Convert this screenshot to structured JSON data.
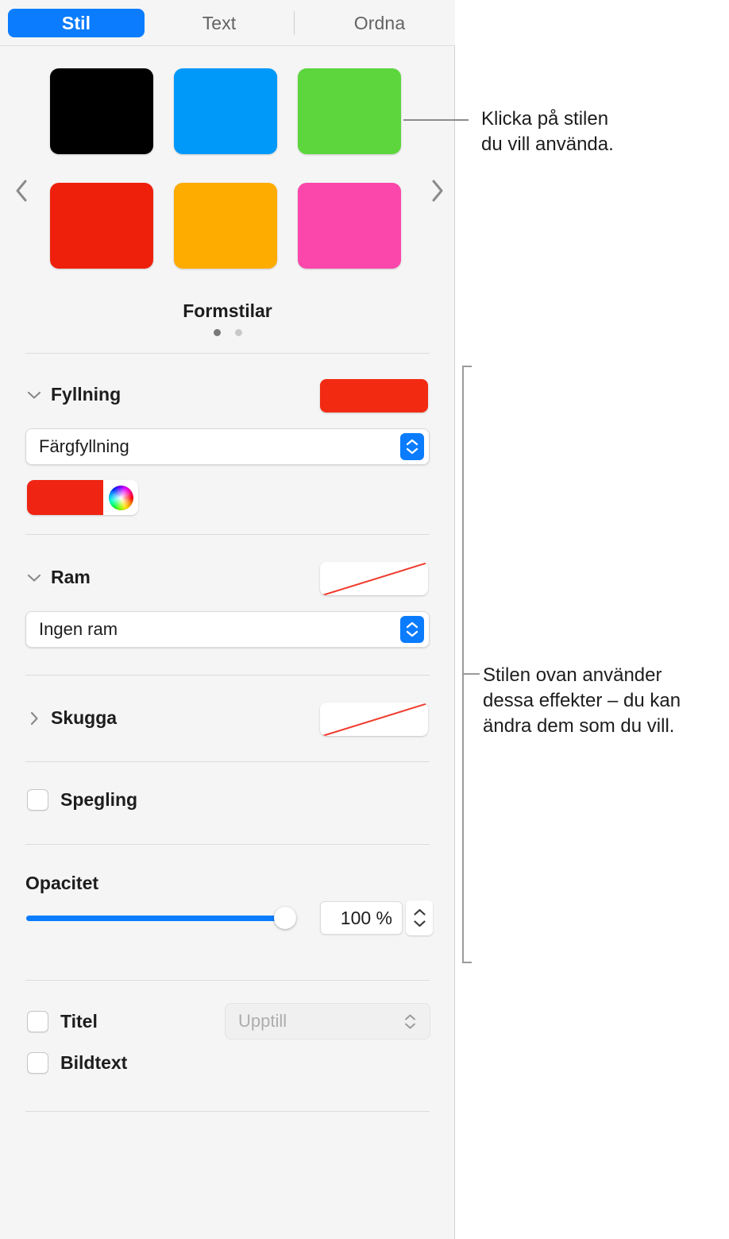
{
  "tabs": [
    {
      "label": "Stil",
      "selected": true
    },
    {
      "label": "Text",
      "selected": false
    },
    {
      "label": "Ordna",
      "selected": false
    }
  ],
  "style_picker": {
    "label": "Formstilar",
    "prev_icon": "chevron-left-icon",
    "next_icon": "chevron-right-icon",
    "page_dots": 2,
    "active_page": 1,
    "swatches": [
      {
        "name": "style-swatch-black",
        "color": "#000000"
      },
      {
        "name": "style-swatch-blue",
        "color": "#0099fa"
      },
      {
        "name": "style-swatch-green",
        "color": "#5cd63c"
      },
      {
        "name": "style-swatch-red",
        "color": "#ee200c"
      },
      {
        "name": "style-swatch-orange",
        "color": "#ffac00"
      },
      {
        "name": "style-swatch-pink",
        "color": "#fb46ab"
      }
    ]
  },
  "fill": {
    "title": "Fyllning",
    "expanded": true,
    "preview_color": "#f22a12",
    "type_value": "Färgfyllning",
    "color_value": "#ef2412"
  },
  "border": {
    "title": "Ram",
    "expanded": true,
    "preview_kind": "none",
    "type_value": "Ingen ram"
  },
  "shadow": {
    "title": "Skugga",
    "expanded": false,
    "preview_kind": "none"
  },
  "reflection": {
    "label": "Spegling",
    "checked": false
  },
  "opacity": {
    "label": "Opacitet",
    "value": "100 %",
    "percent": 100
  },
  "title_row": {
    "label": "Titel",
    "checked": false,
    "position_value": "Upptill",
    "position_disabled": true
  },
  "caption_row": {
    "label": "Bildtext",
    "checked": false
  },
  "callouts": {
    "style_picker": "Klicka på stilen\ndu vill använda.",
    "effects": "Stilen ovan använder\ndessa effekter – du kan\nändra dem som du vill."
  },
  "colors": {
    "accent": "#0a7cfd",
    "panel_bg": "#f5f5f5",
    "separator": "#dcdcdc",
    "callout_line": "#9a9a9a",
    "none_slash": "#f03c2e"
  }
}
